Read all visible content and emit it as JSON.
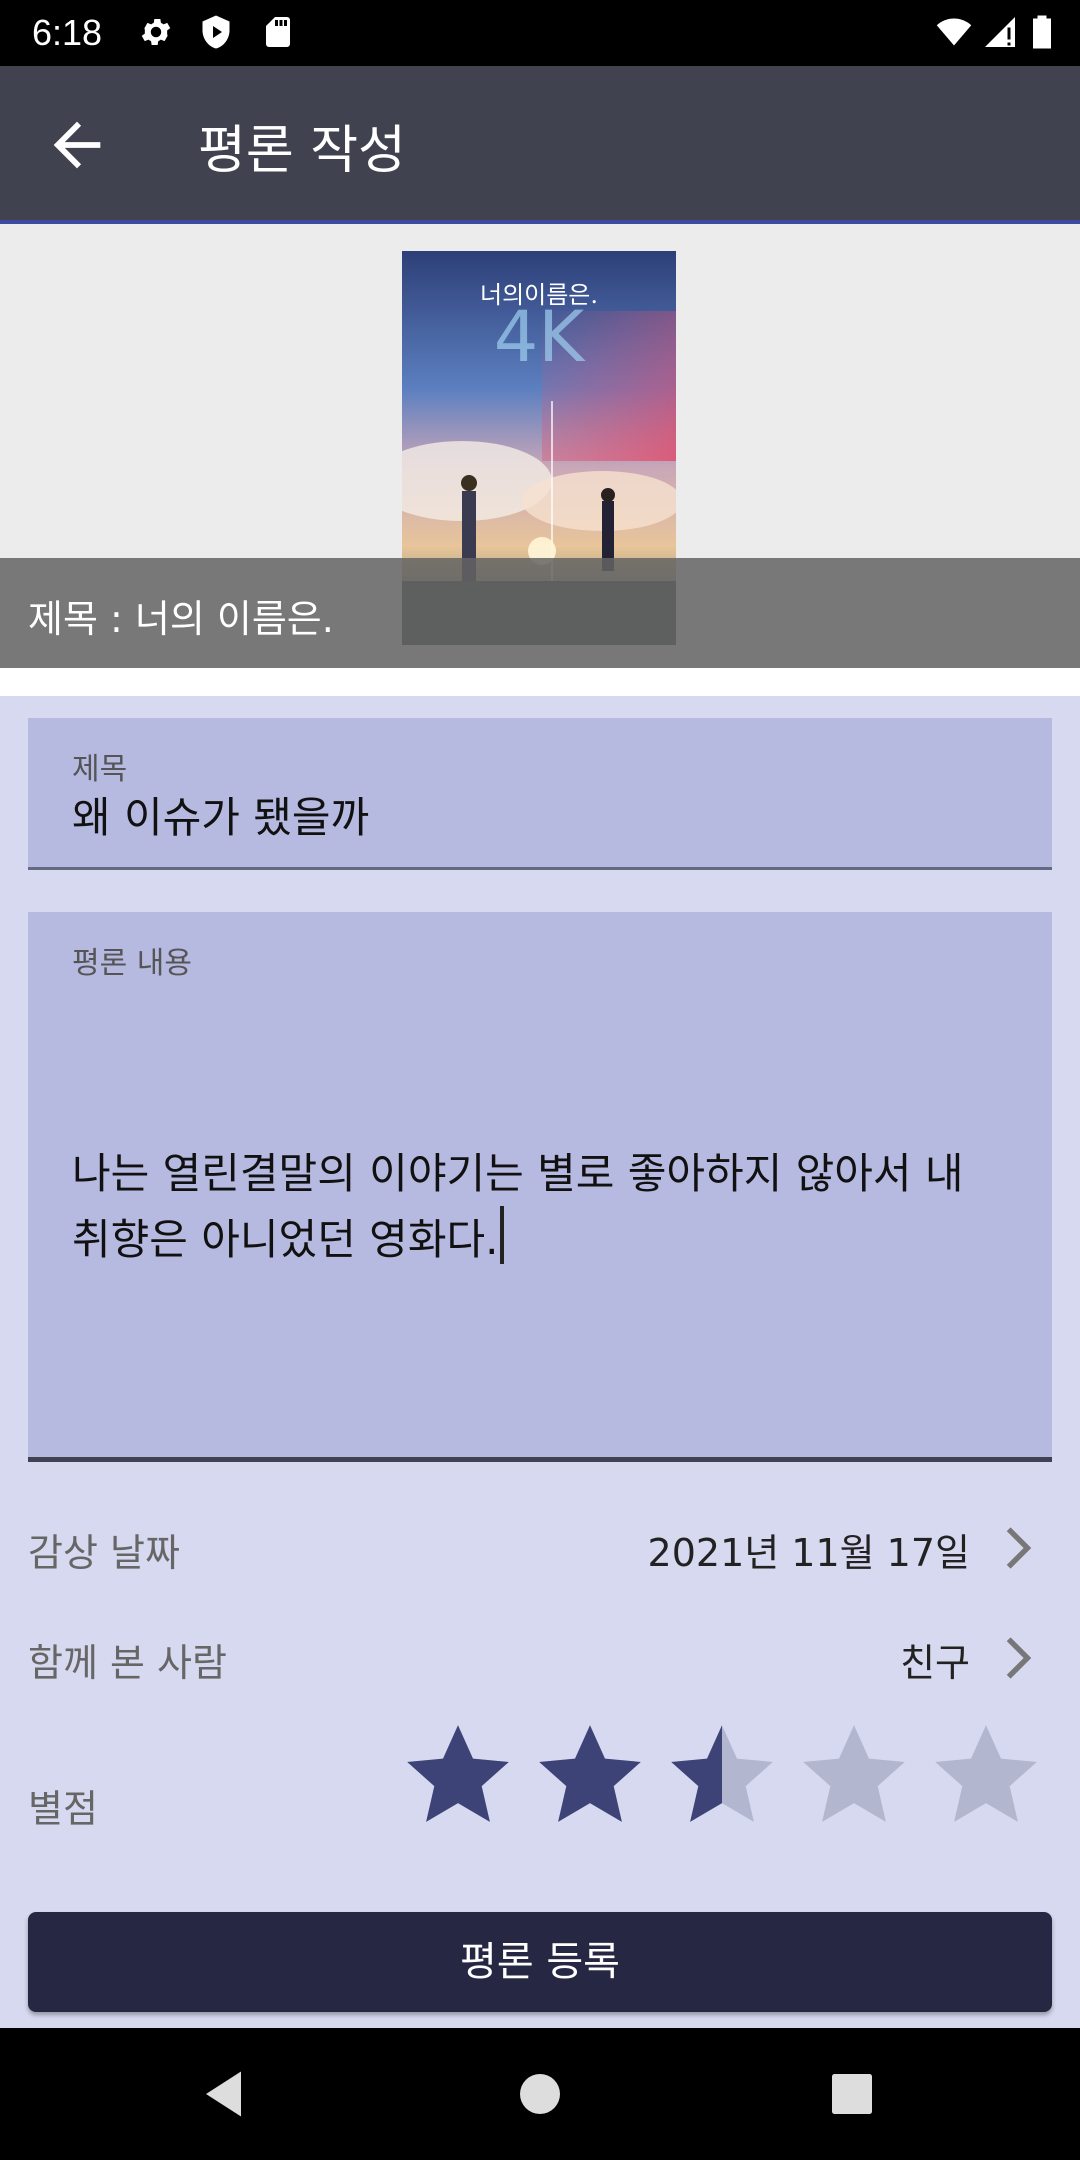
{
  "status_bar": {
    "time": "6:18",
    "icons": [
      "settings-icon",
      "shield-play-icon",
      "sd-card-icon",
      "wifi-icon",
      "signal-icon",
      "battery-icon"
    ]
  },
  "app_bar": {
    "back_icon": "arrow-left-icon",
    "title": "평론 작성"
  },
  "movie": {
    "caption": "제목 : 너의 이름은.",
    "poster_text": "너의이름은.",
    "poster_badge": "4K"
  },
  "form": {
    "title_label": "제목",
    "title_value": "왜 이슈가 됐을까",
    "content_label": "평론 내용",
    "content_value": "나는 열린결말의 이야기는 별로 좋아하지 않아서 내 취향은 아니었던 영화다."
  },
  "details": {
    "date_label": "감상 날짜",
    "date_value": "2021년 11월 17일",
    "companion_label": "함께 본 사람",
    "companion_value": "친구",
    "rating_label": "별점",
    "rating_value": 2.5,
    "rating_max": 5
  },
  "submit_label": "평론 등록",
  "colors": {
    "app_bar": "#40424f",
    "background": "#d6d9ef",
    "field": "#b6b9e0",
    "star_filled": "#3d4277",
    "star_empty": "#b3b6cf",
    "button": "#252743"
  },
  "nav_bar": {
    "icons": [
      "back-triangle-icon",
      "home-circle-icon",
      "recents-square-icon"
    ]
  }
}
